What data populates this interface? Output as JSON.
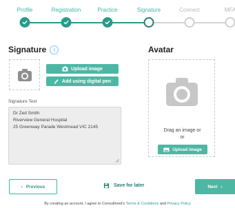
{
  "stepper": {
    "steps": [
      {
        "label": "Profile",
        "state": "done"
      },
      {
        "label": "Registration",
        "state": "done"
      },
      {
        "label": "Practice",
        "state": "done"
      },
      {
        "label": "Signature",
        "state": "current"
      },
      {
        "label": "Connect",
        "state": "todo"
      },
      {
        "label": "MFA",
        "state": "todo"
      }
    ]
  },
  "signature": {
    "title": "Signature",
    "info_icon": "info-icon",
    "upload_label": "Upload image",
    "digital_pen_label": "Add using digital pen",
    "text_label": "Signature Text",
    "text_lines": [
      "Dr Zed Smith",
      "Riverview General Hospital",
      "25 Greenway Parade Westmead VIC 2145"
    ]
  },
  "avatar": {
    "title": "Avatar",
    "drag_text": "Drag an image or",
    "or_text": "or",
    "upload_label": "Upload image"
  },
  "actions": {
    "previous_label": "Previous",
    "save_label": "Save for later",
    "next_label": "Next"
  },
  "footer": {
    "prefix": "By creating an account, I agree to Consultmed's",
    "terms_link": "Terms & Conditions",
    "and_text": "and",
    "privacy_link": "Privacy Policy"
  },
  "colors": {
    "accent": "#4db7a4",
    "accent_dark": "#2a9a8a",
    "step_label": "#3fb5a3",
    "pending": "#cfcfcf"
  }
}
